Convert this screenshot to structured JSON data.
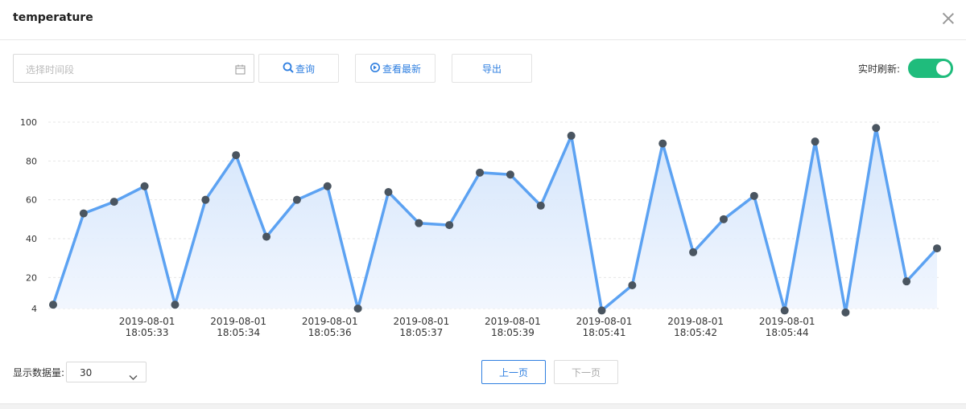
{
  "dialog": {
    "title": "temperature"
  },
  "toolbar": {
    "date_placeholder": "选择时间段",
    "query_label": "查询",
    "latest_label": "查看最新",
    "export_label": "导出",
    "realtime_label": "实时刷新:",
    "realtime_on": true
  },
  "footer": {
    "count_label": "显示数据量:",
    "count_value": "30",
    "prev_label": "上一页",
    "next_label": "下一页"
  },
  "colors": {
    "accent": "#2f7fe0",
    "line": "#5ca2f2",
    "point": "#4a5560",
    "toggle": "#1fbc7c"
  },
  "chart_data": {
    "type": "area",
    "ylim": [
      4,
      100
    ],
    "y_ticks": [
      4,
      20,
      40,
      60,
      80,
      100
    ],
    "grid": true,
    "x_tick_labels": [
      {
        "index": 3,
        "date": "2019-08-01",
        "time": "18:05:33"
      },
      {
        "index": 6,
        "date": "2019-08-01",
        "time": "18:05:34"
      },
      {
        "index": 9,
        "date": "2019-08-01",
        "time": "18:05:36"
      },
      {
        "index": 12,
        "date": "2019-08-01",
        "time": "18:05:37"
      },
      {
        "index": 15,
        "date": "2019-08-01",
        "time": "18:05:39"
      },
      {
        "index": 18,
        "date": "2019-08-01",
        "time": "18:05:41"
      },
      {
        "index": 21,
        "date": "2019-08-01",
        "time": "18:05:42"
      },
      {
        "index": 24,
        "date": "2019-08-01",
        "time": "18:05:44"
      }
    ],
    "values": [
      6,
      53,
      59,
      67,
      6,
      60,
      83,
      41,
      60,
      67,
      4,
      64,
      48,
      47,
      74,
      73,
      57,
      93,
      3,
      16,
      89,
      33,
      50,
      62,
      3,
      90,
      2,
      97,
      18,
      35
    ]
  }
}
